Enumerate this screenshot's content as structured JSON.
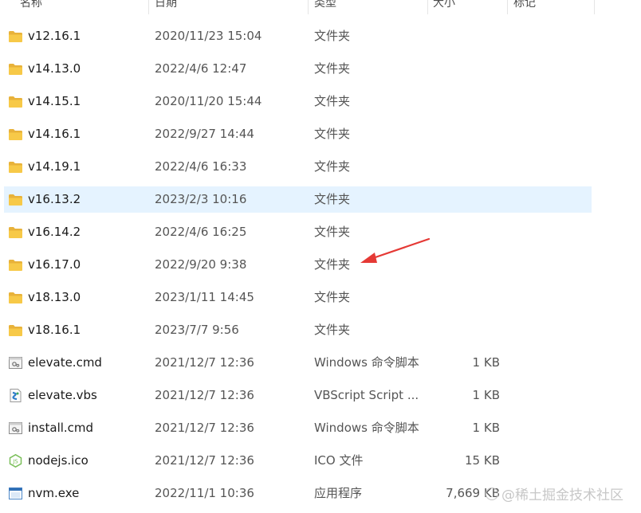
{
  "header": {
    "col_name": "名称",
    "col_date": "日期",
    "col_type": "类型",
    "col_size": "大小",
    "col_tags": "标记"
  },
  "rows": [
    {
      "name": "v12.16.1",
      "date": "2020/11/23 15:04",
      "type": "文件夹",
      "size": "",
      "icon": "folder-icon"
    },
    {
      "name": "v14.13.0",
      "date": "2022/4/6 12:47",
      "type": "文件夹",
      "size": "",
      "icon": "folder-icon"
    },
    {
      "name": "v14.15.1",
      "date": "2020/11/20 15:44",
      "type": "文件夹",
      "size": "",
      "icon": "folder-icon"
    },
    {
      "name": "v14.16.1",
      "date": "2022/9/27 14:44",
      "type": "文件夹",
      "size": "",
      "icon": "folder-icon"
    },
    {
      "name": "v14.19.1",
      "date": "2022/4/6 16:33",
      "type": "文件夹",
      "size": "",
      "icon": "folder-icon"
    },
    {
      "name": "v16.13.2",
      "date": "2023/2/3 10:16",
      "type": "文件夹",
      "size": "",
      "icon": "folder-icon",
      "selected": true
    },
    {
      "name": "v16.14.2",
      "date": "2022/4/6 16:25",
      "type": "文件夹",
      "size": "",
      "icon": "folder-icon"
    },
    {
      "name": "v16.17.0",
      "date": "2022/9/20 9:38",
      "type": "文件夹",
      "size": "",
      "icon": "folder-icon"
    },
    {
      "name": "v18.13.0",
      "date": "2023/1/11 14:45",
      "type": "文件夹",
      "size": "",
      "icon": "folder-icon"
    },
    {
      "name": "v18.16.1",
      "date": "2023/7/7 9:56",
      "type": "文件夹",
      "size": "",
      "icon": "folder-icon"
    },
    {
      "name": "elevate.cmd",
      "date": "2021/12/7 12:36",
      "type": "Windows 命令脚本",
      "size": "1 KB",
      "icon": "cmd-file-icon"
    },
    {
      "name": "elevate.vbs",
      "date": "2021/12/7 12:36",
      "type": "VBScript Script ...",
      "size": "1 KB",
      "icon": "vbs-file-icon"
    },
    {
      "name": "install.cmd",
      "date": "2021/12/7 12:36",
      "type": "Windows 命令脚本",
      "size": "1 KB",
      "icon": "cmd-file-icon"
    },
    {
      "name": "nodejs.ico",
      "date": "2021/12/7 12:36",
      "type": "ICO 文件",
      "size": "15 KB",
      "icon": "nodejs-icon"
    },
    {
      "name": "nvm.exe",
      "date": "2022/11/1 10:36",
      "type": "应用程序",
      "size": "7,669 KB",
      "icon": "exe-file-icon"
    }
  ],
  "watermark": "@稀土掘金技术社区",
  "colors": {
    "selected_row": "#e5f3ff",
    "folder": "#f7c948",
    "arrow": "#e53935"
  }
}
